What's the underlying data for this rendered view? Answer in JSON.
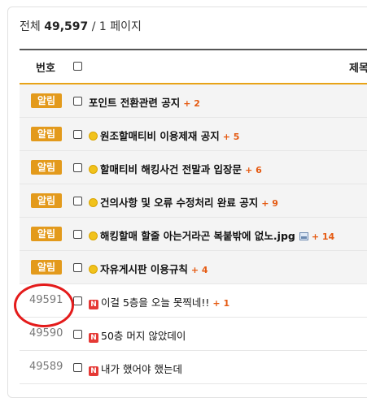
{
  "summary": {
    "total_label": "전체",
    "total_count": "49,597",
    "pages": "/ 1 페이지"
  },
  "header": {
    "num_label": "번호",
    "title_label": "제목"
  },
  "notice_badge": "알림",
  "rows": [
    {
      "type": "notice",
      "subject": "포인트 전환관련 공지",
      "count": "+ 2",
      "medal": false,
      "new": false,
      "image": false
    },
    {
      "type": "notice",
      "subject": "원조할매티비 이용제재 공지",
      "count": "+ 5",
      "medal": true,
      "new": false,
      "image": false
    },
    {
      "type": "notice",
      "subject": "할매티비 해킹사건 전말과 입장문",
      "count": "+ 6",
      "medal": true,
      "new": false,
      "image": false
    },
    {
      "type": "notice",
      "subject": "건의사항 및 오류 수정처리 완료 공지",
      "count": "+ 9",
      "medal": true,
      "new": false,
      "image": false
    },
    {
      "type": "notice",
      "subject": "해킹할매 할줄 아는거라곤 복붙밖에 없노.jpg",
      "count": "+ 14",
      "medal": true,
      "new": false,
      "image": true
    },
    {
      "type": "notice",
      "subject": "자유게시판 이용규칙",
      "count": "+ 4",
      "medal": true,
      "new": false,
      "image": false
    },
    {
      "type": "post",
      "num": "49591",
      "subject": "이걸 5층을 오늘 못찍네!!",
      "count": "+ 1",
      "medal": false,
      "new": true,
      "image": false
    },
    {
      "type": "post",
      "num": "49590",
      "subject": "50층 머지 않았데이",
      "count": "",
      "medal": false,
      "new": true,
      "image": false
    },
    {
      "type": "post",
      "num": "49589",
      "subject": "내가 했어야 했는데",
      "count": "",
      "medal": false,
      "new": true,
      "image": false
    }
  ],
  "new_badge": "N",
  "colors": {
    "accent": "#e39a1c",
    "count": "#e55b13",
    "new": "#e53935",
    "annotation": "#e41b1b"
  }
}
